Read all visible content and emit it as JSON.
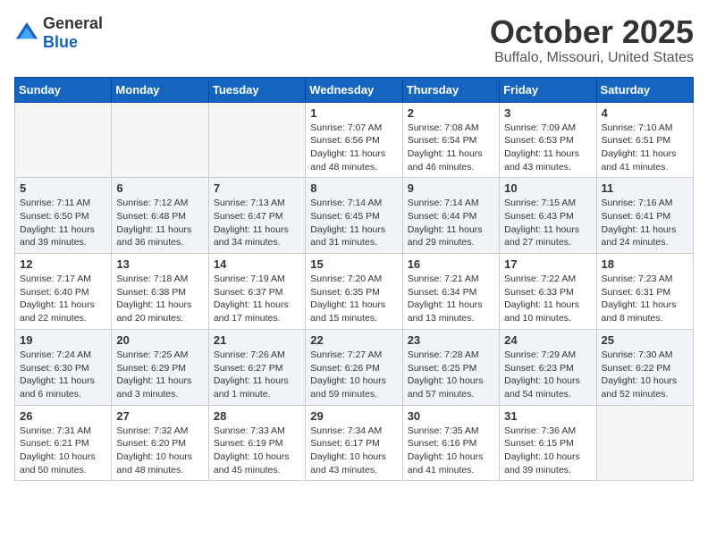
{
  "header": {
    "logo_general": "General",
    "logo_blue": "Blue",
    "month": "October 2025",
    "location": "Buffalo, Missouri, United States"
  },
  "weekdays": [
    "Sunday",
    "Monday",
    "Tuesday",
    "Wednesday",
    "Thursday",
    "Friday",
    "Saturday"
  ],
  "weeks": [
    [
      {
        "day": "",
        "info": ""
      },
      {
        "day": "",
        "info": ""
      },
      {
        "day": "",
        "info": ""
      },
      {
        "day": "1",
        "info": "Sunrise: 7:07 AM\nSunset: 6:56 PM\nDaylight: 11 hours\nand 48 minutes."
      },
      {
        "day": "2",
        "info": "Sunrise: 7:08 AM\nSunset: 6:54 PM\nDaylight: 11 hours\nand 46 minutes."
      },
      {
        "day": "3",
        "info": "Sunrise: 7:09 AM\nSunset: 6:53 PM\nDaylight: 11 hours\nand 43 minutes."
      },
      {
        "day": "4",
        "info": "Sunrise: 7:10 AM\nSunset: 6:51 PM\nDaylight: 11 hours\nand 41 minutes."
      }
    ],
    [
      {
        "day": "5",
        "info": "Sunrise: 7:11 AM\nSunset: 6:50 PM\nDaylight: 11 hours\nand 39 minutes."
      },
      {
        "day": "6",
        "info": "Sunrise: 7:12 AM\nSunset: 6:48 PM\nDaylight: 11 hours\nand 36 minutes."
      },
      {
        "day": "7",
        "info": "Sunrise: 7:13 AM\nSunset: 6:47 PM\nDaylight: 11 hours\nand 34 minutes."
      },
      {
        "day": "8",
        "info": "Sunrise: 7:14 AM\nSunset: 6:45 PM\nDaylight: 11 hours\nand 31 minutes."
      },
      {
        "day": "9",
        "info": "Sunrise: 7:14 AM\nSunset: 6:44 PM\nDaylight: 11 hours\nand 29 minutes."
      },
      {
        "day": "10",
        "info": "Sunrise: 7:15 AM\nSunset: 6:43 PM\nDaylight: 11 hours\nand 27 minutes."
      },
      {
        "day": "11",
        "info": "Sunrise: 7:16 AM\nSunset: 6:41 PM\nDaylight: 11 hours\nand 24 minutes."
      }
    ],
    [
      {
        "day": "12",
        "info": "Sunrise: 7:17 AM\nSunset: 6:40 PM\nDaylight: 11 hours\nand 22 minutes."
      },
      {
        "day": "13",
        "info": "Sunrise: 7:18 AM\nSunset: 6:38 PM\nDaylight: 11 hours\nand 20 minutes."
      },
      {
        "day": "14",
        "info": "Sunrise: 7:19 AM\nSunset: 6:37 PM\nDaylight: 11 hours\nand 17 minutes."
      },
      {
        "day": "15",
        "info": "Sunrise: 7:20 AM\nSunset: 6:35 PM\nDaylight: 11 hours\nand 15 minutes."
      },
      {
        "day": "16",
        "info": "Sunrise: 7:21 AM\nSunset: 6:34 PM\nDaylight: 11 hours\nand 13 minutes."
      },
      {
        "day": "17",
        "info": "Sunrise: 7:22 AM\nSunset: 6:33 PM\nDaylight: 11 hours\nand 10 minutes."
      },
      {
        "day": "18",
        "info": "Sunrise: 7:23 AM\nSunset: 6:31 PM\nDaylight: 11 hours\nand 8 minutes."
      }
    ],
    [
      {
        "day": "19",
        "info": "Sunrise: 7:24 AM\nSunset: 6:30 PM\nDaylight: 11 hours\nand 6 minutes."
      },
      {
        "day": "20",
        "info": "Sunrise: 7:25 AM\nSunset: 6:29 PM\nDaylight: 11 hours\nand 3 minutes."
      },
      {
        "day": "21",
        "info": "Sunrise: 7:26 AM\nSunset: 6:27 PM\nDaylight: 11 hours\nand 1 minute."
      },
      {
        "day": "22",
        "info": "Sunrise: 7:27 AM\nSunset: 6:26 PM\nDaylight: 10 hours\nand 59 minutes."
      },
      {
        "day": "23",
        "info": "Sunrise: 7:28 AM\nSunset: 6:25 PM\nDaylight: 10 hours\nand 57 minutes."
      },
      {
        "day": "24",
        "info": "Sunrise: 7:29 AM\nSunset: 6:23 PM\nDaylight: 10 hours\nand 54 minutes."
      },
      {
        "day": "25",
        "info": "Sunrise: 7:30 AM\nSunset: 6:22 PM\nDaylight: 10 hours\nand 52 minutes."
      }
    ],
    [
      {
        "day": "26",
        "info": "Sunrise: 7:31 AM\nSunset: 6:21 PM\nDaylight: 10 hours\nand 50 minutes."
      },
      {
        "day": "27",
        "info": "Sunrise: 7:32 AM\nSunset: 6:20 PM\nDaylight: 10 hours\nand 48 minutes."
      },
      {
        "day": "28",
        "info": "Sunrise: 7:33 AM\nSunset: 6:19 PM\nDaylight: 10 hours\nand 45 minutes."
      },
      {
        "day": "29",
        "info": "Sunrise: 7:34 AM\nSunset: 6:17 PM\nDaylight: 10 hours\nand 43 minutes."
      },
      {
        "day": "30",
        "info": "Sunrise: 7:35 AM\nSunset: 6:16 PM\nDaylight: 10 hours\nand 41 minutes."
      },
      {
        "day": "31",
        "info": "Sunrise: 7:36 AM\nSunset: 6:15 PM\nDaylight: 10 hours\nand 39 minutes."
      },
      {
        "day": "",
        "info": ""
      }
    ]
  ]
}
